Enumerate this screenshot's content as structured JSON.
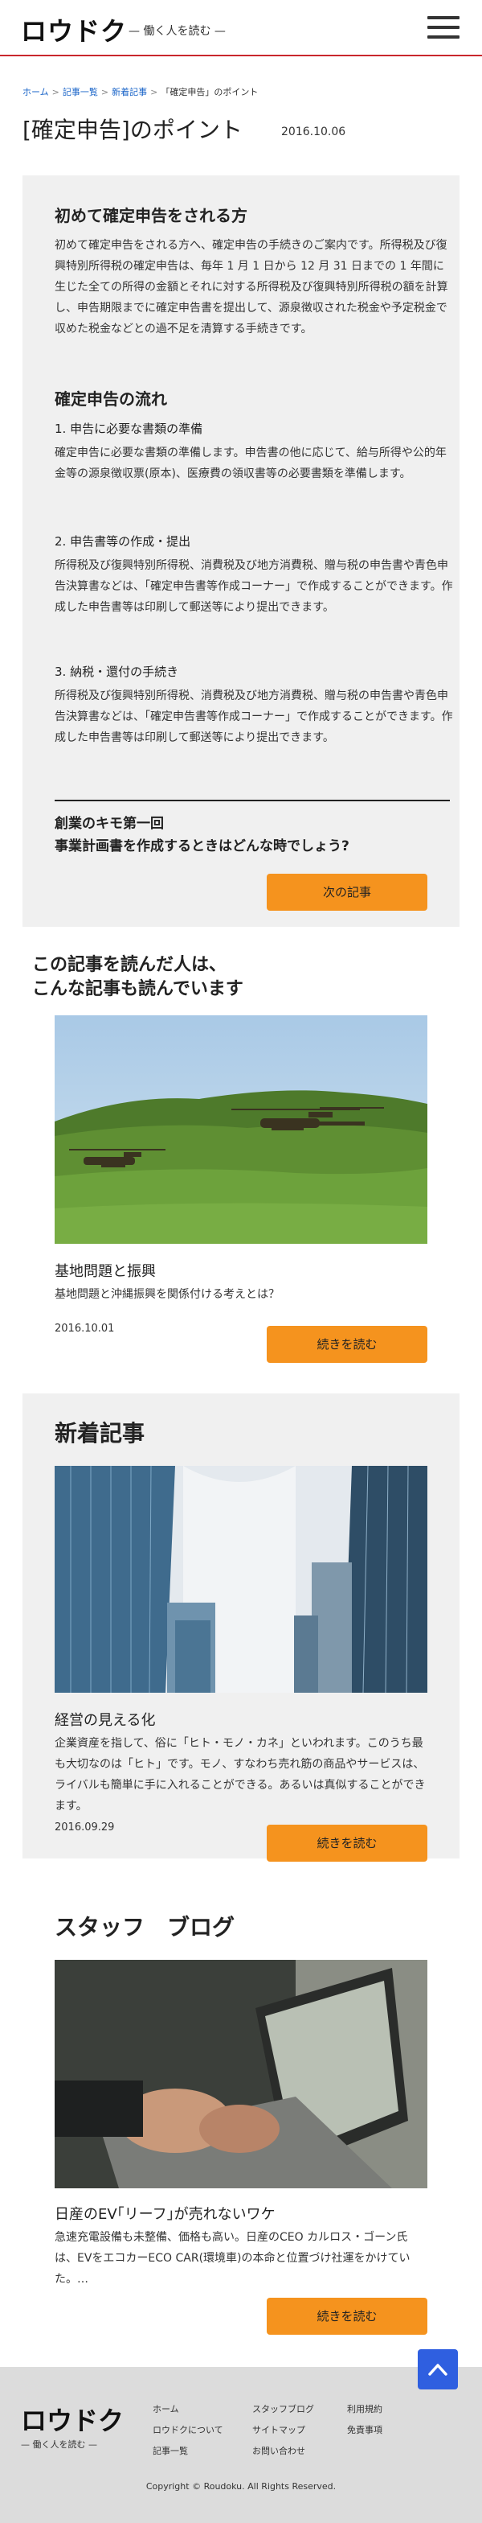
{
  "header": {
    "logo": "ロウドク",
    "tagline": "— 働く人を読む —"
  },
  "breadcrumb": {
    "items": [
      "ホーム",
      "記事一覧",
      "新着記事",
      "「確定申告」のポイント"
    ],
    "separator": ">"
  },
  "article": {
    "title": "[確定申告]のポイント",
    "date": "2016.10.06",
    "intro_heading": "初めて確定申告をされる方",
    "intro_text": "初めて確定申告をされる方へ、確定申告の手続きのご案内です。所得税及び復興特別所得税の確定申告は、毎年 1 月 1 日から 12 月 31 日までの 1 年間に生じた全ての所得の金額とそれに対する所得税及び復興特別所得税の額を計算し、申告期限までに確定申告書を提出して、源泉徴収された税金や予定税金で収めた税金などとの過不足を清算する手続きです。",
    "flow_heading": "確定申告の流れ",
    "steps": [
      {
        "title": "1. 申告に必要な書類の準備",
        "text": "確定申告に必要な書類の準備します。申告書の他に応じて、給与所得や公的年金等の源泉徴収票(原本)、医療費の領収書等の必要書類を準備します。"
      },
      {
        "title": "2. 申告書等の作成・提出",
        "text": "所得税及び復興特別所得税、消費税及び地方消費税、贈与税の申告書や青色申告決算書などは、「確定申告書等作成コーナー」で作成することができます。作成した申告書等は印刷して郵送等により提出できます。"
      },
      {
        "title": "3. 納税・還付の手続き",
        "text": "所得税及び復興特別所得税、消費税及び地方消費税、贈与税の申告書や青色申告決算書などは、「確定申告書等作成コーナー」で作成することができます。作成した申告書等は印刷して郵送等により提出できます。"
      }
    ],
    "next_title_line1": "創業のキモ第一回",
    "next_title_line2": "事業計画書を作成するときはどんな時でしょう?",
    "next_button": "次の記事"
  },
  "related": {
    "heading_line1": "この記事を読んだ人は、",
    "heading_line2": "こんな記事も読んでいます",
    "title": "基地問題と振興",
    "text": "基地問題と沖縄振興を関係付ける考えとは？",
    "date": "2016.10.01",
    "button": "続きを読む"
  },
  "new_articles": {
    "heading": "新着記事",
    "title": "経営の見える化",
    "text": "企業資産を指して、俗に「ヒト・モノ・カネ」といわれます。このうち最も大切なのは「ヒト」です。モノ、すなわち売れ筋の商品やサービスは、ライバルも簡単に手に入れることができる。あるいは真似することができます。",
    "date": "2016.09.29",
    "button": "続きを読む"
  },
  "staff_blog": {
    "heading": "スタッフ　ブログ",
    "title": "日産のEV｢リーフ｣が売れないワケ",
    "text": "急速充電設備も未整備、価格も高い。日産のCEO カルロス・ゴーン氏は、EVをエコカーECO CAR(環境車)の本命と位置づけ社運をかけていた。…",
    "button": "続きを読む"
  },
  "footer": {
    "logo": "ロウドク",
    "tagline": "— 働く人を読む —",
    "links_col1": [
      "ホーム",
      "ロウドクについて",
      "記事一覧"
    ],
    "links_col2": [
      "スタッフブログ",
      "サイトマップ",
      "お問い合わせ"
    ],
    "links_col3": [
      "利用規約",
      "免責事項"
    ],
    "copyright": "Copyright © Roudoku. All Rights Reserved."
  },
  "colors": {
    "accent_red": "#c9282d",
    "button_orange": "#f5931e",
    "back_top_blue": "#2f5fe0",
    "panel_gray": "#f0f0f0",
    "footer_gray": "#dcdcdc"
  },
  "icons": [
    "menu-icon",
    "arrow-up-icon"
  ]
}
